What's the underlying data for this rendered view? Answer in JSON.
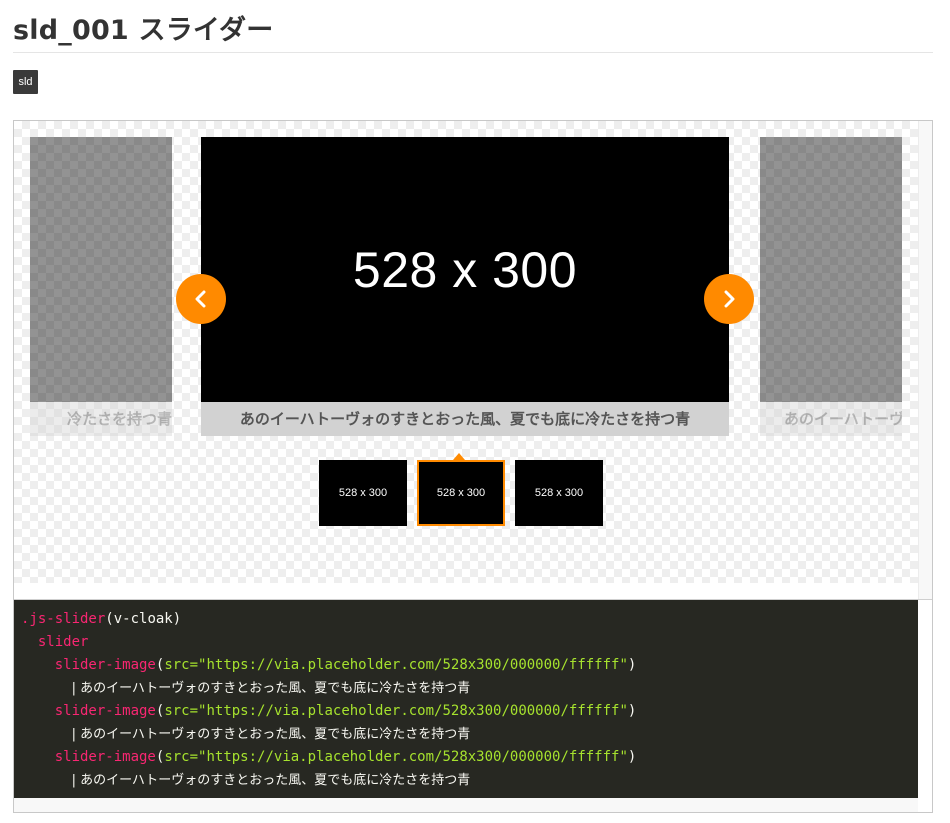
{
  "page": {
    "title": "sld_001 スライダー",
    "tag": "sld"
  },
  "slider": {
    "prev_slide_caption": "冷たさを持つ青",
    "next_slide_caption": "あのイーハトーヴ",
    "current_slide": {
      "image_label": "528 x 300",
      "caption": "あのイーハトーヴォのすきとおった風、夏でも底に冷たさを持つ青"
    },
    "arrow_prev": "‹",
    "arrow_next": "›",
    "thumbnails": [
      {
        "label": "528 x 300"
      },
      {
        "label": "528 x 300",
        "active": true
      },
      {
        "label": "528 x 300"
      }
    ],
    "accent_color": "#ff8a00"
  },
  "code": {
    "line1_cls": ".js-slider",
    "line1_rest": "(v-cloak)",
    "line2": "slider",
    "items": [
      {
        "tag": "slider-image",
        "attr": "src=",
        "value": "\"https://via.placeholder.com/528x300/000000/ffffff\"",
        "text": "| あのイーハトーヴォのすきとおった風、夏でも底に冷たさを持つ青"
      },
      {
        "tag": "slider-image",
        "attr": "src=",
        "value": "\"https://via.placeholder.com/528x300/000000/ffffff\"",
        "text": "| あのイーハトーヴォのすきとおった風、夏でも底に冷たさを持つ青"
      },
      {
        "tag": "slider-image",
        "attr": "src=",
        "value": "\"https://via.placeholder.com/528x300/000000/ffffff\"",
        "text": "| あのイーハトーヴォのすきとおった風、夏でも底に冷たさを持つ青"
      }
    ]
  }
}
